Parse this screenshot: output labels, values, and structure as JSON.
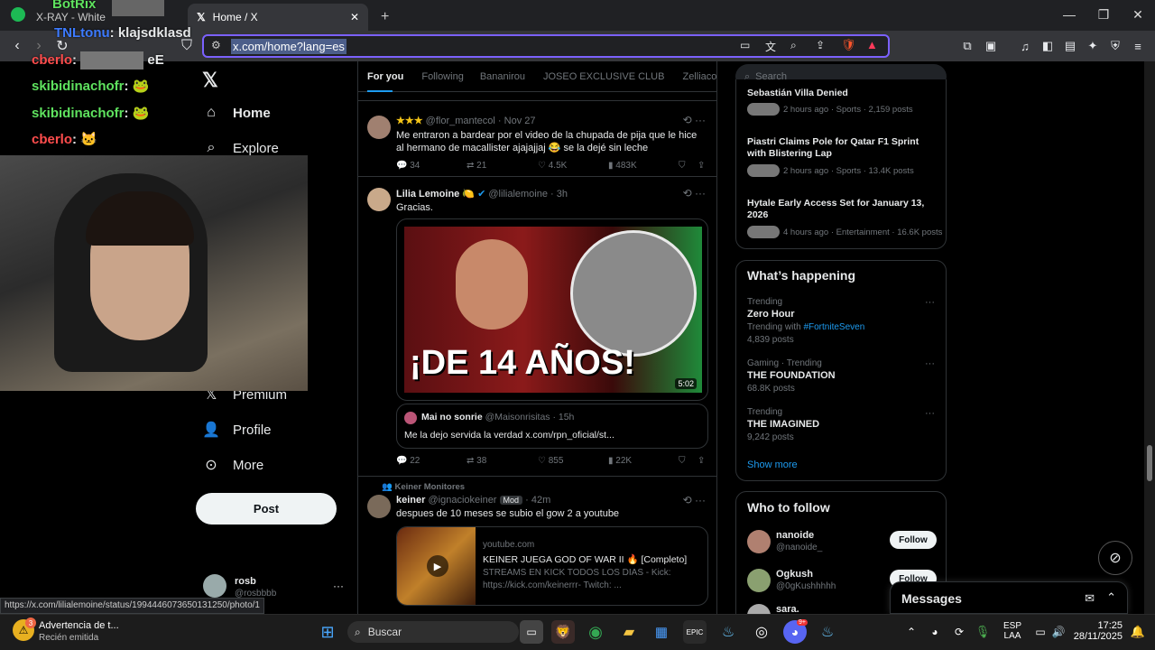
{
  "browser": {
    "tabs": [
      {
        "label": "X-RAY - White"
      },
      {
        "label": "Home / X"
      }
    ],
    "new_tab": "+",
    "url": "x.com/home?lang=es",
    "status_url": "https://x.com/lilialemoine/status/1994446073650131250/photo/1"
  },
  "overlay": {
    "chat": [
      {
        "user": "BotRix",
        "color": "#5fe35f",
        "text": ""
      },
      {
        "user": "TNLtonu",
        "color": "#3d7bff",
        "text": "klajsdklasd"
      },
      {
        "user": "cberlo",
        "color": "#ff4d4d",
        "text": "eE"
      },
      {
        "user": "skibidinachofr",
        "color": "#5fe35f",
        "text": ""
      },
      {
        "user": "skibidinachofr",
        "color": "#5fe35f",
        "text": ""
      },
      {
        "user": "cberlo",
        "color": "#ff4d4d",
        "text": ""
      }
    ]
  },
  "nav": {
    "home": "Home",
    "explore": "Explore",
    "premium": "Premium",
    "profile": "Profile",
    "more": "More",
    "post": "Post",
    "account_name": "rosb",
    "account_handle": "@rosbbbb"
  },
  "timeline": {
    "tabs": [
      "For you",
      "Following",
      "Bananirou",
      "JOSEO EXCLUSIVE CLUB",
      "Zelliacos"
    ],
    "tweets": [
      {
        "name": "★★★",
        "handle": "@flor_mantecol",
        "time": "· Nov 27",
        "text": "Me entraron a bardear por el video de la chupada de pija que le hice al hermano de macallister ajajajjaj 😂 se la dejé sin leche",
        "replies": "34",
        "reposts": "21",
        "likes": "4.5K",
        "views": "483K"
      },
      {
        "name": "Lilia Lemoine 🍋",
        "handle": "@lilialemoine",
        "time": "· 3h",
        "text": "Gracias.",
        "media_title": "¡DE 14 AÑOS!",
        "media_duration": "5:02",
        "quote_name": "Mai no sonrie",
        "quote_handle": "@Maisonrisitas",
        "quote_time": "· 15h",
        "quote_text": "Me la dejo servida la verdad x.com/rpn_oficial/st...",
        "replies": "22",
        "reposts": "38",
        "likes": "855",
        "views": "22K"
      },
      {
        "context": "Keiner Monitores",
        "name": "keiner",
        "handle": "@ignaciokeiner",
        "badge": "Mod",
        "time": "· 42m",
        "text": "despues de 10 meses se subio el gow 2 a youtube",
        "card_domain": "youtube.com",
        "card_title": "KEINER JUEGA GOD OF WAR II 🔥 [Completo]",
        "card_desc": "STREAMS EN KICK TODOS LOS DIAS - Kick: https://kick.com/keinerrr- Twitch: ..."
      }
    ]
  },
  "right": {
    "search_placeholder": "Search",
    "news": [
      {
        "title": "Sebastián Villa Denied",
        "meta": "2 hours ago · Sports · 2,159 posts"
      },
      {
        "title": "Piastri Claims Pole for Qatar F1 Sprint with Blistering Lap",
        "meta": "2 hours ago · Sports · 13.4K posts"
      },
      {
        "title": "Hytale Early Access Set for January 13, 2026",
        "meta": "4 hours ago · Entertainment · 16.6K posts"
      }
    ],
    "happening_title": "What’s happening",
    "trends": [
      {
        "context": "Trending",
        "name": "Zero Hour",
        "extra_label": "Trending with",
        "extra_tag": "#FortniteSeven",
        "posts": "4,839 posts"
      },
      {
        "context": "Gaming · Trending",
        "name": "THE FOUNDATION",
        "posts": "68.8K posts"
      },
      {
        "context": "Trending",
        "name": "THE IMAGINED",
        "posts": "9,242 posts"
      }
    ],
    "show_more": "Show more",
    "who_title": "Who to follow",
    "follows": [
      {
        "name": "nanoide",
        "handle": "@nanoide_",
        "button": "Follow"
      },
      {
        "name": "Ogkush",
        "handle": "@0gKushhhhh",
        "button": "Follow"
      },
      {
        "name": "sara.",
        "handle": "",
        "button": "Follow"
      }
    ],
    "messages": "Messages"
  },
  "taskbar": {
    "notification_title": "Advertencia de t...",
    "notification_sub": "Recién emitida",
    "notification_count": "3",
    "search": "Buscar",
    "lang_top": "ESP",
    "lang_bottom": "LAA",
    "time": "17:25",
    "date": "28/11/2025",
    "discord_badge": "9+"
  }
}
